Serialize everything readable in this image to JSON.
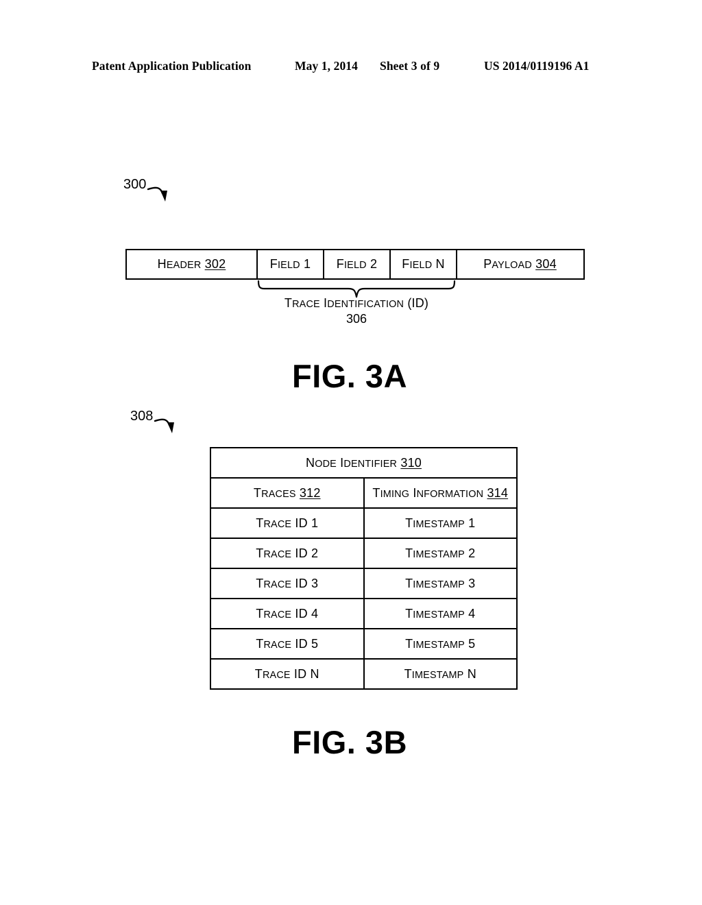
{
  "page_header": {
    "publication": "Patent Application Publication",
    "date": "May 1, 2014",
    "sheet": "Sheet 3 of 9",
    "patent_number": "US 2014/0119196 A1"
  },
  "fig_3a": {
    "title": "FIG. 3A",
    "callout": "300",
    "packet_cells": [
      {
        "name": "header",
        "label": "Header",
        "ref": "302"
      },
      {
        "name": "field1",
        "label": "Field 1",
        "ref": ""
      },
      {
        "name": "field2",
        "label": "Field 2",
        "ref": ""
      },
      {
        "name": "fieldn",
        "label": "Field N",
        "ref": ""
      },
      {
        "name": "payload",
        "label": "Payload",
        "ref": "304"
      }
    ],
    "brace_caption": "Trace Identification (ID)",
    "brace_ref": "306"
  },
  "fig_3b": {
    "title": "FIG. 3B",
    "callout": "308",
    "table_title": {
      "label": "Node Identifier",
      "ref": "310"
    },
    "columns": [
      {
        "label": "Traces",
        "ref": "312"
      },
      {
        "label": "Timing Information",
        "ref": "314"
      }
    ],
    "rows": [
      {
        "trace": "Trace ID 1",
        "timestamp": "Timestamp 1"
      },
      {
        "trace": "Trace ID 2",
        "timestamp": "Timestamp 2"
      },
      {
        "trace": "Trace ID 3",
        "timestamp": "Timestamp 3"
      },
      {
        "trace": "Trace ID 4",
        "timestamp": "Timestamp 4"
      },
      {
        "trace": "Trace ID 5",
        "timestamp": "Timestamp 5"
      },
      {
        "trace": "Trace ID N",
        "timestamp": "Timestamp N"
      }
    ]
  },
  "colors": {
    "ink": "#000000",
    "paper": "#ffffff"
  }
}
